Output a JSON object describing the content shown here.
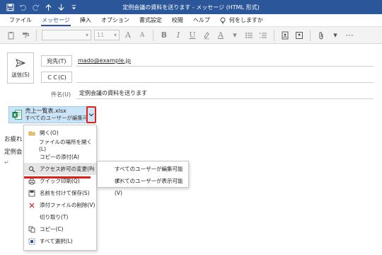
{
  "window": {
    "title": "定例会議の資料を送ります - メッセージ (HTML 形式)"
  },
  "tabs": [
    "ファイル",
    "メッセージ",
    "挿入",
    "オプション",
    "書式設定",
    "校閲",
    "ヘルプ"
  ],
  "active_tab": "メッセージ",
  "tell_me": "何をしますか",
  "ribbon": {
    "font_size": "11"
  },
  "compose": {
    "send_label": "送信(S)",
    "to_label": "宛先(T)",
    "to_value": "mado@example.jp",
    "cc_label": "ＣＣ(C)",
    "subject_label": "件名(U)",
    "subject_value": "定例会議の資料を送ります"
  },
  "attachment": {
    "name": "売上一覧表.xlsx",
    "permission": "すべてのユーザーが編集可能"
  },
  "body": {
    "line1": "お疲れ",
    "line2": "定例会",
    "para_mark": "↵"
  },
  "context_menu": {
    "items": [
      {
        "label": "開く(O)",
        "icon": "open-icon"
      },
      {
        "label": "ファイルの場所を開く(L)",
        "icon": ""
      },
      {
        "label": "コピーの添付(A)",
        "icon": ""
      },
      {
        "label": "アクセス許可の変更(P)",
        "icon": "search-icon",
        "submenu": true
      },
      {
        "label": "クイック印刷(Q)",
        "icon": "print-icon"
      },
      {
        "label": "名前を付けて保存(S)",
        "icon": "save-as-icon"
      },
      {
        "label": "添付ファイルの削除(V)",
        "icon": "delete-icon"
      },
      {
        "label": "切り取り(T)",
        "icon": ""
      },
      {
        "label": "コピー(C)",
        "icon": "copy-icon"
      },
      {
        "label": "すべて選択(L)",
        "icon": "select-all-icon"
      }
    ]
  },
  "submenu": {
    "items": [
      "すべてのユーザーが編集可能(E)",
      "すべてのユーザーが表示可能(V)"
    ]
  },
  "colors": {
    "title_bar": "#2b579a",
    "highlight": "#e0201b",
    "attachment_bg": "#cce4f7"
  }
}
